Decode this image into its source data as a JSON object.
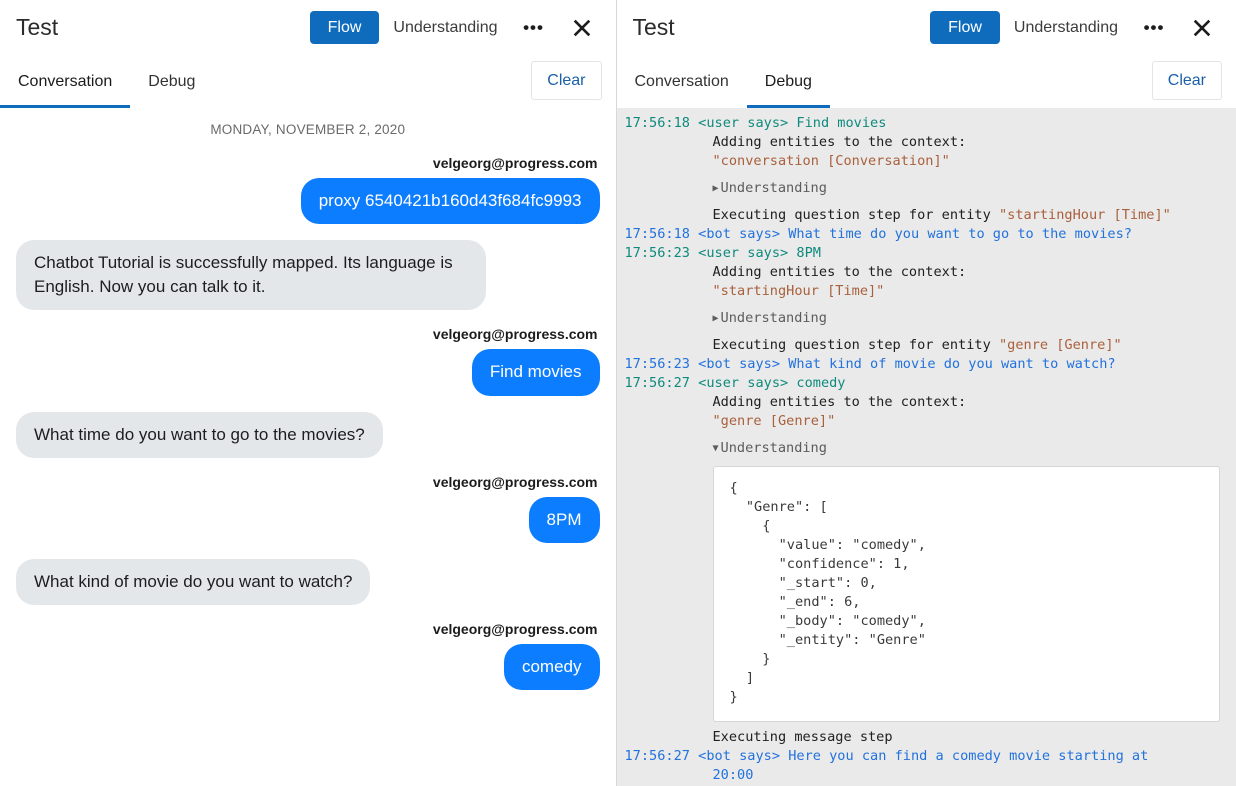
{
  "left_panel": {
    "title": "Test",
    "header_buttons": {
      "flow": "Flow",
      "understanding": "Understanding",
      "more_icon": "•••",
      "close_icon": "close-icon"
    },
    "tabs": [
      {
        "label": "Conversation",
        "active": true
      },
      {
        "label": "Debug",
        "active": false
      }
    ],
    "clear_label": "Clear",
    "conversation": {
      "date_divider": "MONDAY, NOVEMBER 2, 2020",
      "messages": [
        {
          "direction": "out",
          "author": "velgeorg@progress.com",
          "text": "proxy 6540421b160d43f684fc9993"
        },
        {
          "direction": "in",
          "author": "",
          "text": "Chatbot Tutorial is successfully mapped. Its language is English. Now you can talk to it."
        },
        {
          "direction": "out",
          "author": "velgeorg@progress.com",
          "text": "Find movies"
        },
        {
          "direction": "in",
          "author": "",
          "text": "What time do you want to go to the movies?"
        },
        {
          "direction": "out",
          "author": "velgeorg@progress.com",
          "text": "8PM"
        },
        {
          "direction": "in",
          "author": "",
          "text": "What kind of movie do you want to watch?"
        },
        {
          "direction": "out",
          "author": "velgeorg@progress.com",
          "text": "comedy"
        }
      ]
    }
  },
  "right_panel": {
    "title": "Test",
    "header_buttons": {
      "flow": "Flow",
      "understanding": "Understanding",
      "more_icon": "•••",
      "close_icon": "close-icon"
    },
    "tabs": [
      {
        "label": "Conversation",
        "active": false
      },
      {
        "label": "Debug",
        "active": true
      }
    ],
    "clear_label": "Clear",
    "debug_log": [
      {
        "kind": "event",
        "timestamp": "17:56:18",
        "speaker": "<user says>",
        "role": "user",
        "text": "Find movies"
      },
      {
        "kind": "plain",
        "timestamp": "",
        "text": "Adding entities to the context:"
      },
      {
        "kind": "entity",
        "timestamp": "",
        "text": "\"conversation [Conversation]\""
      },
      {
        "kind": "disclosure",
        "arrow": "▶",
        "label": "Understanding",
        "expanded": false
      },
      {
        "kind": "mixed",
        "timestamp": "",
        "plain": "Executing question step for entity ",
        "entity": "\"startingHour [Time]\""
      },
      {
        "kind": "event",
        "timestamp": "17:56:18",
        "speaker": "<bot says>",
        "role": "bot",
        "text": "What time do you want to go to the movies?"
      },
      {
        "kind": "event",
        "timestamp": "17:56:23",
        "speaker": "<user says>",
        "role": "user",
        "text": "8PM"
      },
      {
        "kind": "plain",
        "timestamp": "",
        "text": "Adding entities to the context:"
      },
      {
        "kind": "entity",
        "timestamp": "",
        "text": "\"startingHour [Time]\""
      },
      {
        "kind": "disclosure",
        "arrow": "▶",
        "label": "Understanding",
        "expanded": false
      },
      {
        "kind": "mixed",
        "timestamp": "",
        "plain": "Executing question step for entity ",
        "entity": "\"genre [Genre]\""
      },
      {
        "kind": "event",
        "timestamp": "17:56:23",
        "speaker": "<bot says>",
        "role": "bot",
        "text": "What kind of movie do you want to watch?"
      },
      {
        "kind": "event",
        "timestamp": "17:56:27",
        "speaker": "<user says>",
        "role": "user",
        "text": "comedy"
      },
      {
        "kind": "plain",
        "timestamp": "",
        "text": "Adding entities to the context:"
      },
      {
        "kind": "entity",
        "timestamp": "",
        "text": "\"genre [Genre]\""
      },
      {
        "kind": "disclosure",
        "arrow": "▼",
        "label": "Understanding",
        "expanded": true
      },
      {
        "kind": "json",
        "text": "{\n  \"Genre\": [\n    {\n      \"value\": \"comedy\",\n      \"confidence\": 1,\n      \"_start\": 0,\n      \"_end\": 6,\n      \"_body\": \"comedy\",\n      \"_entity\": \"Genre\"\n    }\n  ]\n}"
      },
      {
        "kind": "plain",
        "timestamp": "",
        "text": "Executing message step"
      },
      {
        "kind": "event",
        "timestamp": "17:56:27",
        "speaker": "<bot says>",
        "role": "bot",
        "text": "Here you can find a comedy movie starting at"
      },
      {
        "kind": "cont",
        "timestamp": "",
        "role": "bot",
        "text": "20:00"
      }
    ]
  },
  "colors": {
    "accent_blue": "#0f6cbd",
    "bubble_blue": "#0d7dff",
    "bubble_gray": "#e4e7ea",
    "debug_bg": "#eaeaea",
    "user_green": "#0e8a7d",
    "bot_blue": "#2272dd",
    "entity_brown": "#a9603c",
    "clear_link": "#1b5fa8"
  }
}
